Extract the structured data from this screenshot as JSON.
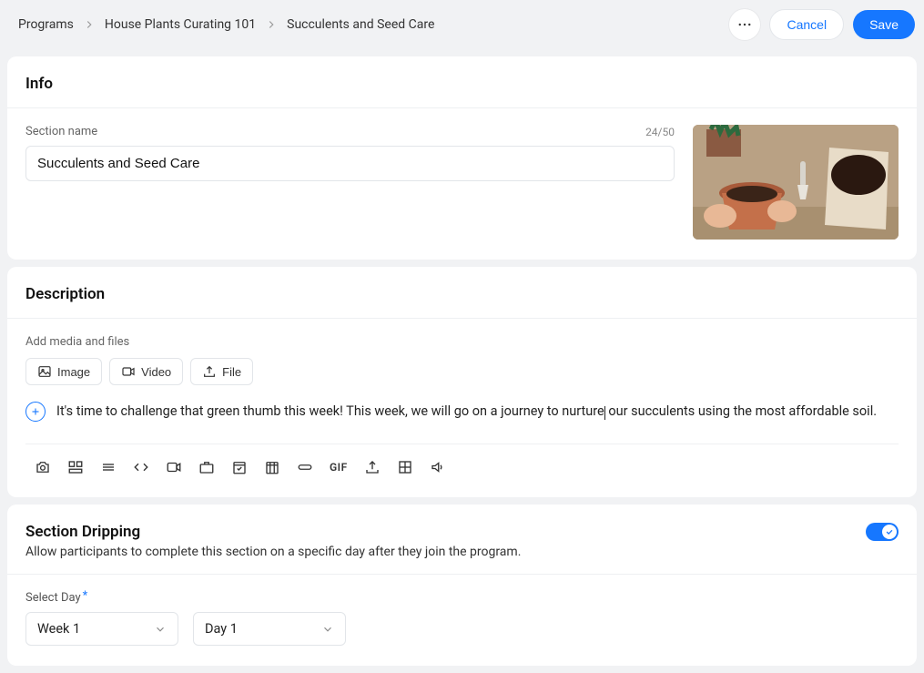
{
  "breadcrumb": {
    "items": [
      "Programs",
      "House Plants Curating 101",
      "Succulents and Seed Care"
    ]
  },
  "actions": {
    "cancel": "Cancel",
    "save": "Save"
  },
  "info": {
    "title": "Info",
    "section_name_label": "Section name",
    "section_name_value": "Succulents and Seed Care",
    "counter": "24/50"
  },
  "description": {
    "title": "Description",
    "media_label": "Add media and files",
    "buttons": {
      "image": "Image",
      "video": "Video",
      "file": "File"
    },
    "text_before": "It's time to challenge that green thumb this week! This week, we will go on a journey to nurture",
    "text_after": " our succulents using the most affordable soil.",
    "gif_label": "GIF"
  },
  "dripping": {
    "title": "Section Dripping",
    "desc": "Allow participants to complete this section on a specific day after they join the program.",
    "enabled": true,
    "select_label": "Select Day",
    "week_value": "Week 1",
    "day_value": "Day 1"
  }
}
